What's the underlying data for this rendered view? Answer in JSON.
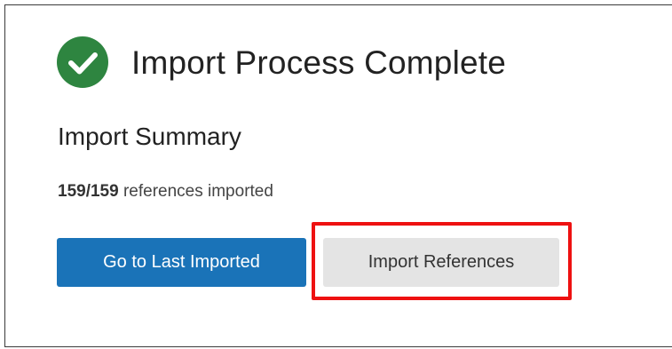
{
  "header": {
    "title": "Import Process Complete",
    "status_icon": "check-circle-icon",
    "status_color": "#2e8540"
  },
  "summary": {
    "title": "Import Summary",
    "count": "159/159",
    "text": " references imported"
  },
  "actions": {
    "primary_label": "Go to Last Imported",
    "secondary_label": "Import References",
    "primary_color": "#1a73b8",
    "secondary_color": "#e4e4e4",
    "highlight_color": "#ee1111"
  }
}
